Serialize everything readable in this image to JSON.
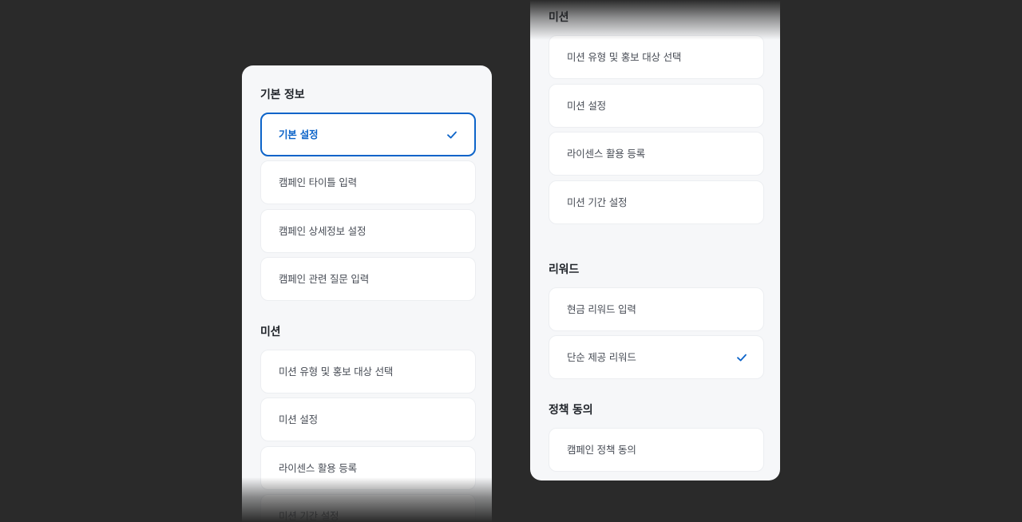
{
  "left_panel": {
    "basic_title": "기본 정보",
    "basic_items": [
      {
        "label": "기본 설정"
      },
      {
        "label": "캠페인 타이틀 입력"
      },
      {
        "label": "캠페인 상세정보 설정"
      },
      {
        "label": "캠페인 관련 질문 입력"
      }
    ],
    "mission_title": "미션",
    "mission_items": [
      {
        "label": "미션 유형 및 홍보 대상 선택"
      },
      {
        "label": "미션 설정"
      },
      {
        "label": "라이센스 활용 등록"
      },
      {
        "label": "미션 기간 설정"
      }
    ]
  },
  "right_panel": {
    "mission_title": "미션",
    "mission_items": [
      {
        "label": "미션 유형 및 홍보 대상 선택"
      },
      {
        "label": "미션 설정"
      },
      {
        "label": "라이센스 활용 등록"
      },
      {
        "label": "미션 기간 설정"
      }
    ],
    "reward_title": "리워드",
    "reward_items": [
      {
        "label": "현금 리워드 입력"
      },
      {
        "label": "단순 제공 리워드"
      }
    ],
    "policy_title": "정책 동의",
    "policy_items": [
      {
        "label": "캠페인 정책 동의"
      }
    ]
  },
  "icons": {
    "check": "check-icon"
  },
  "colors": {
    "accent": "#0d64c9",
    "background": "#2a2a2a",
    "panel": "#f6f7f9",
    "card": "#ffffff",
    "text": "#474c55",
    "heading": "#1f2329"
  }
}
